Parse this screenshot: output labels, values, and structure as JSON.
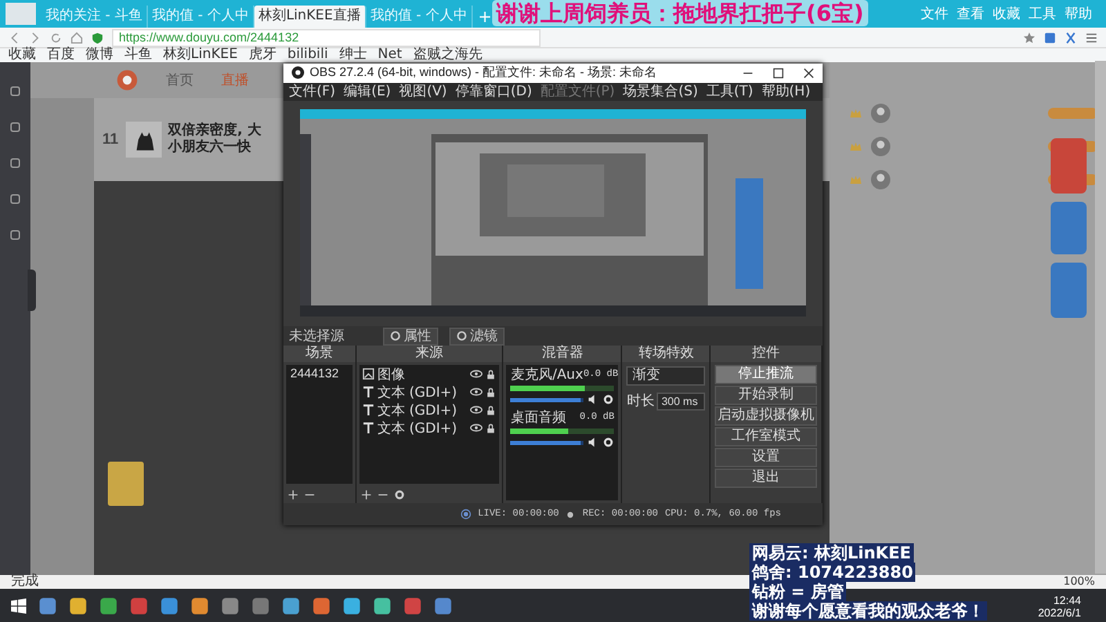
{
  "browser": {
    "tabs": [
      {
        "label": "我的关注 - 斗鱼",
        "selected": false
      },
      {
        "label": "我的值 - 个人中",
        "selected": false
      },
      {
        "label": "林刻LinKEE直播",
        "selected": true
      },
      {
        "label": "我的值 - 个人中",
        "selected": false
      }
    ],
    "new_tab": "+",
    "menu": [
      "文件",
      "查看",
      "收藏",
      "工具",
      "帮助"
    ],
    "url": "https://www.douyu.com/2444132",
    "bookmarks": [
      "收藏",
      "百度",
      "微博",
      "斗鱼",
      "林刻LinKEE",
      "虎牙",
      "bilibili",
      "绅士",
      "Net",
      "盗贼之海先"
    ],
    "status": "完成",
    "zoom": "100%"
  },
  "banner": "谢谢上周饲养员：拖地界扛把子(6宝)",
  "page": {
    "nav": [
      {
        "label": "首页",
        "selected": false
      },
      {
        "label": "直播",
        "selected": true
      }
    ],
    "stat_value": "11",
    "room_title": "双倍亲密度, 大小朋友六一快"
  },
  "obs": {
    "title": "OBS 27.2.4 (64-bit, windows) - 配置文件: 未命名 - 场景: 未命名",
    "menu": [
      {
        "label": "文件(F)",
        "disabled": false
      },
      {
        "label": "编辑(E)",
        "disabled": false
      },
      {
        "label": "视图(V)",
        "disabled": false
      },
      {
        "label": "停靠窗口(D)",
        "disabled": false
      },
      {
        "label": "配置文件(P)",
        "disabled": true
      },
      {
        "label": "场景集合(S)",
        "disabled": false
      },
      {
        "label": "工具(T)",
        "disabled": false
      },
      {
        "label": "帮助(H)",
        "disabled": false
      }
    ],
    "source_label": "未选择源",
    "source_buttons": [
      "属性",
      "滤镜"
    ],
    "scenes": {
      "title": "场景",
      "items": [
        {
          "label": "2444132",
          "selected": false
        }
      ]
    },
    "sources": {
      "title": "来源",
      "items": [
        {
          "kind": "image",
          "label": "图像"
        },
        {
          "kind": "text",
          "label": "文本 (GDI+)"
        },
        {
          "kind": "text",
          "label": "文本 (GDI+)"
        },
        {
          "kind": "text",
          "label": "文本 (GDI+)"
        }
      ]
    },
    "mixer": {
      "title": "混音器",
      "channels": [
        {
          "name": "麦克风/Aux",
          "reading": "0.0 dB",
          "level": 0.72,
          "volume": {
            "level": 0.95
          }
        },
        {
          "name": "桌面音频",
          "reading": "0.0 dB",
          "level": 0.55,
          "volume": {
            "level": 0.95
          }
        }
      ]
    },
    "transitions": {
      "title": "转场特效",
      "type": "渐变",
      "duration_label": "时长",
      "duration": "300 ms"
    },
    "controls": {
      "title": "控件",
      "buttons": [
        {
          "label": "停止推流",
          "hovered": true
        },
        {
          "label": "开始录制",
          "hovered": false
        },
        {
          "label": "启动虚拟摄像机",
          "hovered": false
        },
        {
          "label": "工作室模式",
          "hovered": false
        },
        {
          "label": "设置",
          "hovered": false
        },
        {
          "label": "退出",
          "hovered": false
        }
      ]
    },
    "status": [
      "LIVE: 00:00:00",
      "REC: 00:00:00",
      "CPU: 0.7%, 60.00 fps"
    ]
  },
  "caption": [
    "网易云: 林刻LinKEE",
    "鸽舍: 1074223880",
    "钻粉 = 房管",
    "谢谢每个愿意看我的观众老爷！"
  ],
  "taskbar": {
    "time": "12:44",
    "date": "2022/6/1"
  }
}
